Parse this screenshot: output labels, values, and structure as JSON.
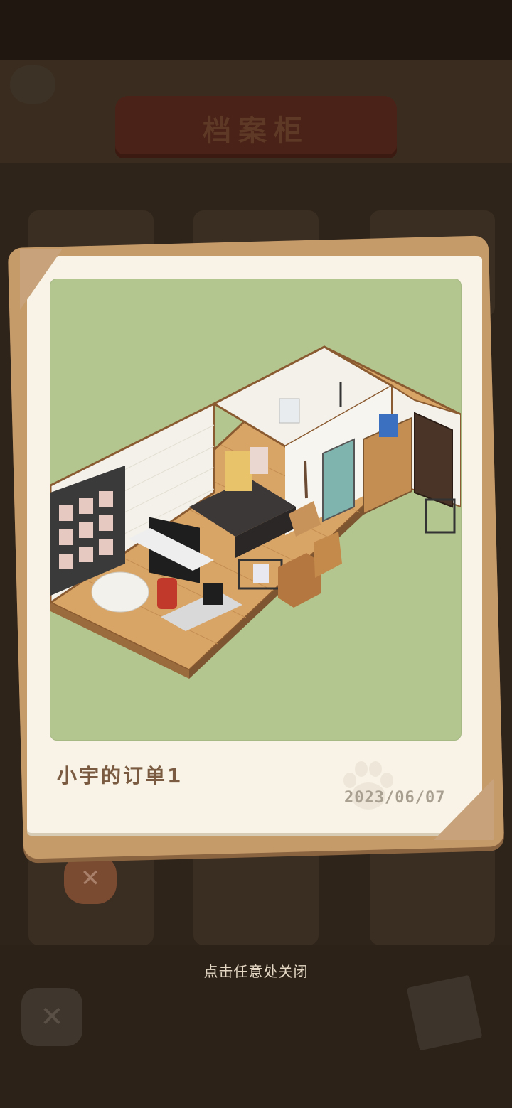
{
  "background": {
    "cabinet_title": "档案柜",
    "close_pin_symbol": "✕",
    "close_button_symbol": "✕"
  },
  "photo_card": {
    "title": "小宇的订单1",
    "date": "2023/06/07",
    "photo_bg_color": "#b3c68f",
    "paw_icon": "paw-print-icon"
  },
  "hint": {
    "text": "点击任意处关闭"
  },
  "colors": {
    "frame": "#f8f3e6",
    "frame_wood": "#c69b6a",
    "title_text": "#7a5a40",
    "date_text": "#a89f90"
  }
}
